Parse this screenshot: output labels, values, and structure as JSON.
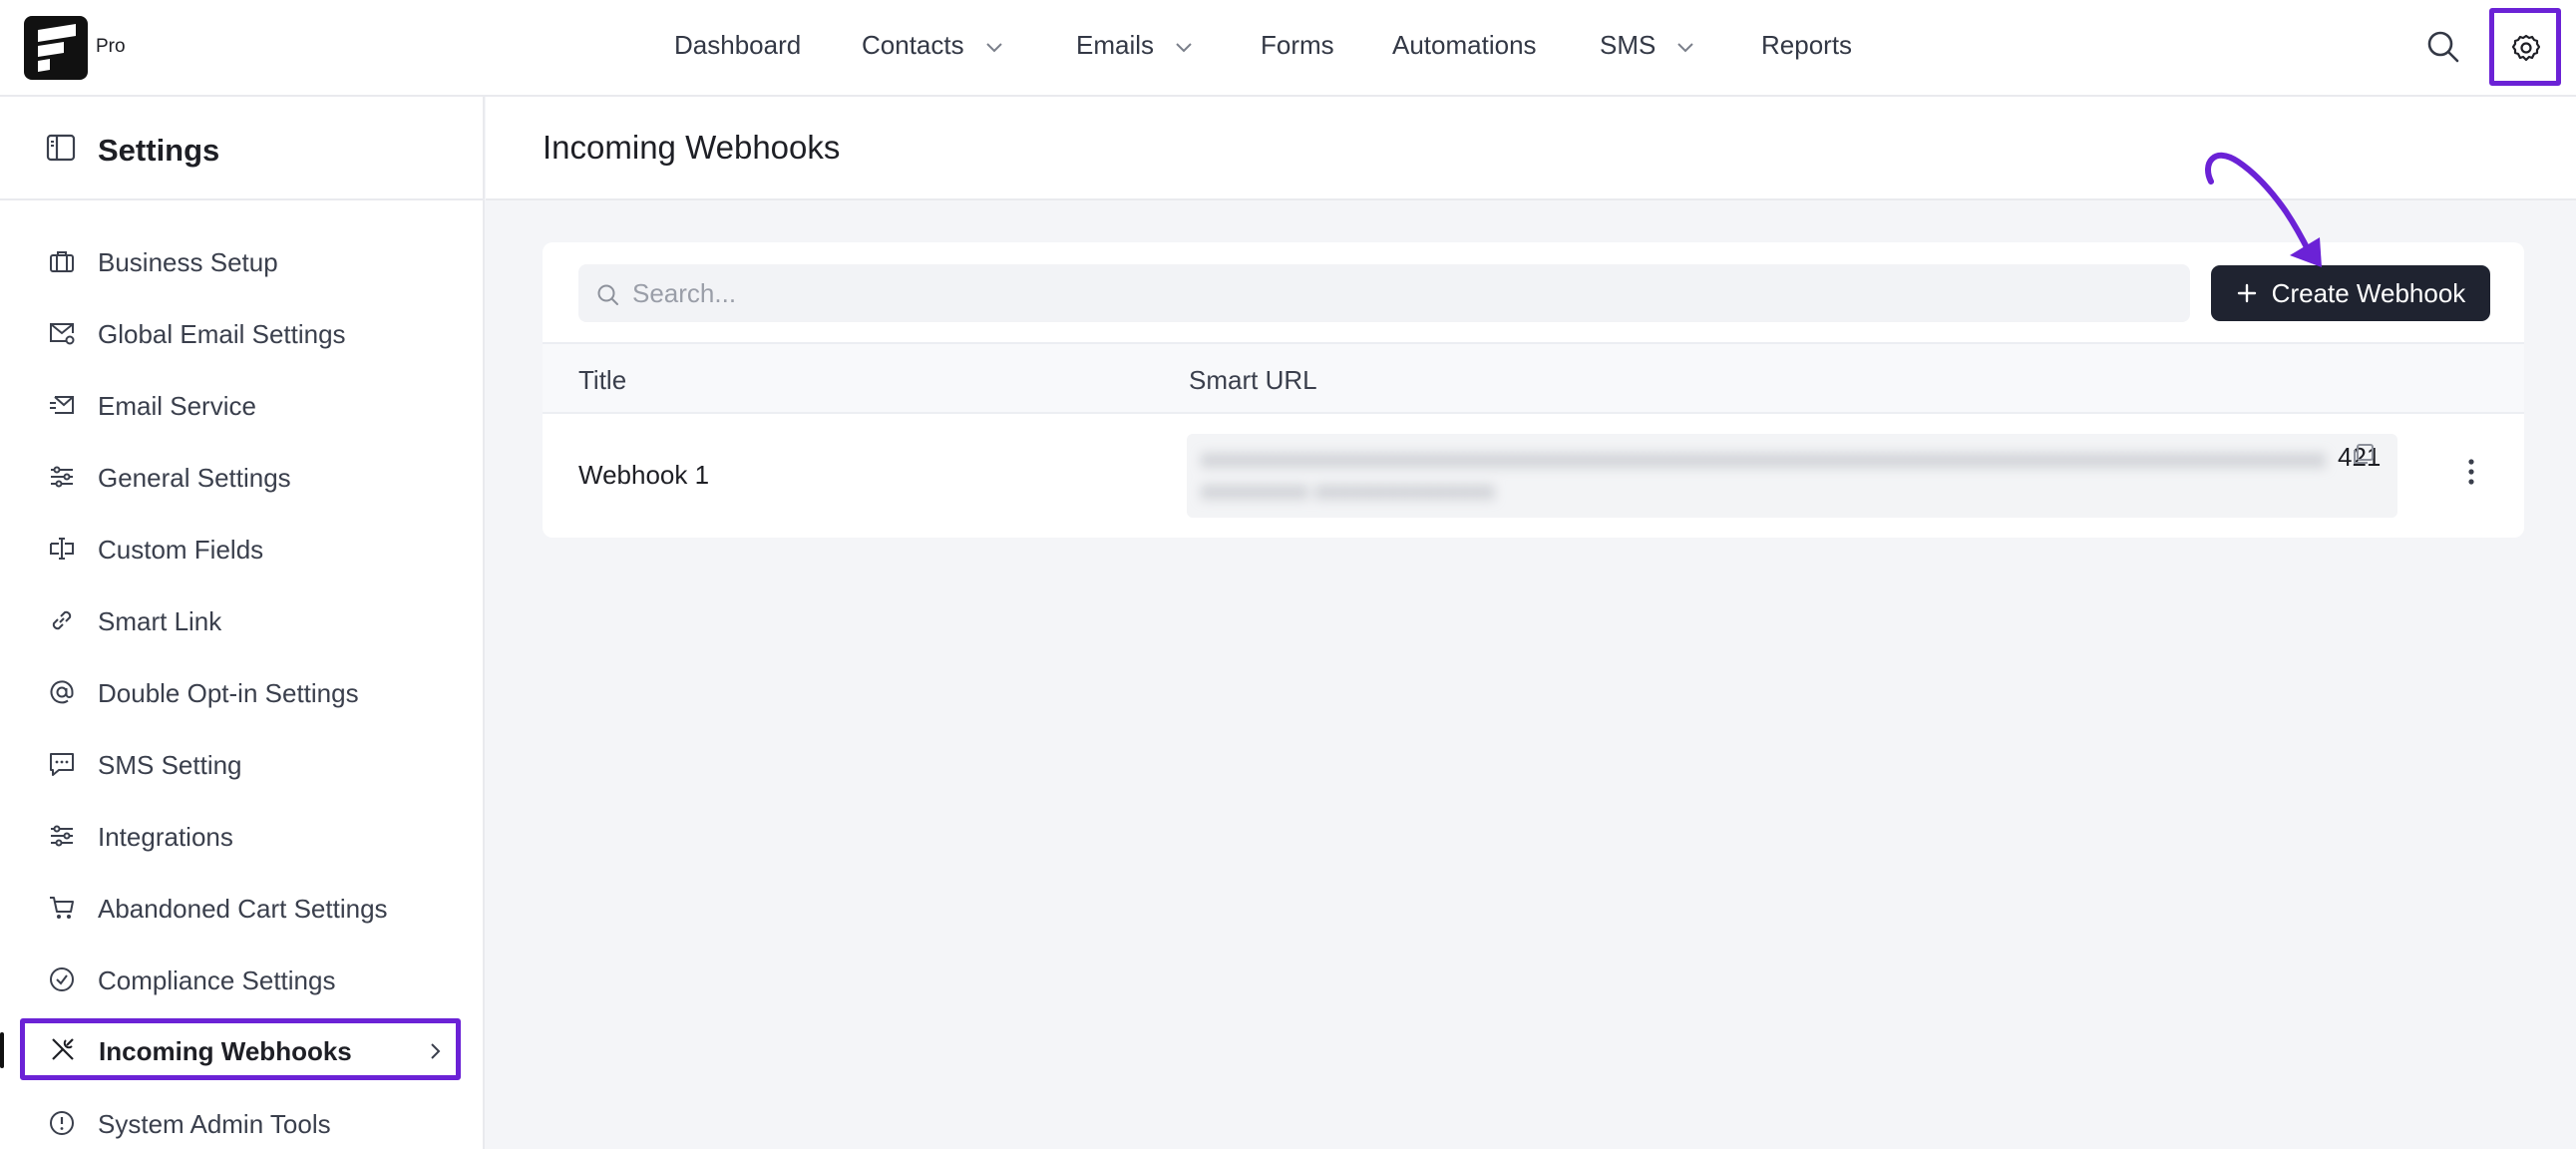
{
  "app": {
    "badge": "Pro",
    "logo_icon": "fluentcrm-logo-icon"
  },
  "nav": {
    "items": [
      {
        "label": "Dashboard",
        "dropdown": false
      },
      {
        "label": "Contacts",
        "dropdown": true
      },
      {
        "label": "Emails",
        "dropdown": true
      },
      {
        "label": "Forms",
        "dropdown": false
      },
      {
        "label": "Automations",
        "dropdown": false
      },
      {
        "label": "SMS",
        "dropdown": true
      },
      {
        "label": "Reports",
        "dropdown": false
      }
    ],
    "search_icon": "search-icon",
    "settings_icon": "gear-icon"
  },
  "sidebar": {
    "title": "Settings",
    "items": [
      {
        "label": "Business Setup",
        "icon": "briefcase-icon"
      },
      {
        "label": "Global Email Settings",
        "icon": "mail-settings-icon"
      },
      {
        "label": "Email Service",
        "icon": "mail-send-icon"
      },
      {
        "label": "General Settings",
        "icon": "sliders-icon"
      },
      {
        "label": "Custom Fields",
        "icon": "custom-field-icon"
      },
      {
        "label": "Smart Link",
        "icon": "link-icon"
      },
      {
        "label": "Double Opt-in Settings",
        "icon": "at-sign-icon"
      },
      {
        "label": "SMS Setting",
        "icon": "message-icon"
      },
      {
        "label": "Integrations",
        "icon": "sliders-icon"
      },
      {
        "label": "Abandoned Cart Settings",
        "icon": "cart-icon"
      },
      {
        "label": "Compliance Settings",
        "icon": "check-circle-icon"
      },
      {
        "label": "Incoming Webhooks",
        "icon": "tools-icon",
        "active": true
      },
      {
        "label": "System Admin Tools",
        "icon": "alert-circle-icon"
      }
    ]
  },
  "main": {
    "title": "Incoming Webhooks",
    "search_placeholder": "Search...",
    "create_button": "Create Webhook",
    "columns": [
      "Title",
      "Smart URL"
    ],
    "rows": [
      {
        "title": "Webhook 1",
        "url_tail": "421"
      }
    ]
  },
  "colors": {
    "highlight": "#6b22d6",
    "primary_button": "#1f2330"
  }
}
